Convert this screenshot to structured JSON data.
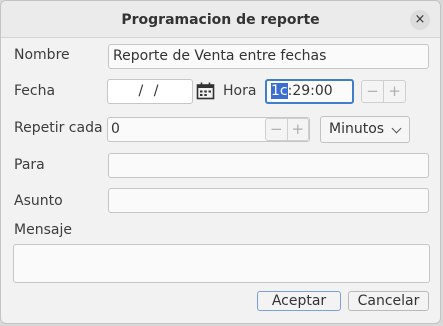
{
  "window": {
    "title": "Programacion de reporte",
    "close_glyph": "×"
  },
  "form": {
    "nombre": {
      "label": "Nombre",
      "value": "Reporte de Venta entre fechas"
    },
    "fecha": {
      "label": "Fecha",
      "value": "/ /",
      "icon": "calendar-icon"
    },
    "hora": {
      "label": "Hora",
      "value_selected": "1c",
      "value_rest": ":29:00",
      "minus": "−",
      "plus": "+"
    },
    "repetir": {
      "label": "Repetir cada",
      "value": "0",
      "minus": "−",
      "plus": "+",
      "unit": "Minutos"
    },
    "para": {
      "label": "Para",
      "value": ""
    },
    "asunto": {
      "label": "Asunto",
      "value": ""
    },
    "mensaje": {
      "label": "Mensaje",
      "value": ""
    }
  },
  "actions": {
    "accept": "Aceptar",
    "cancel": "Cancelar"
  },
  "colors": {
    "accent": "#3f7ecb",
    "selection": "#3a6ed0"
  }
}
